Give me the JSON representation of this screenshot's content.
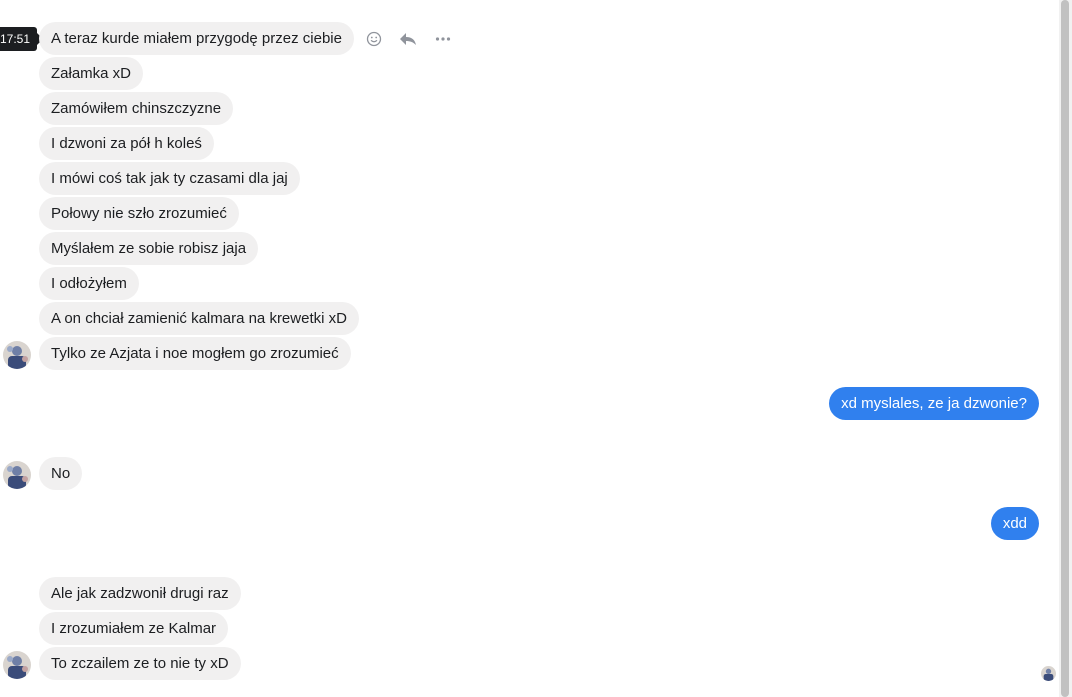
{
  "tooltip": {
    "time": "17:51"
  },
  "actions": {
    "react_icon": "smiley-icon",
    "reply_icon": "reply-icon",
    "more_icon": "more-icon"
  },
  "messages": [
    {
      "text": "A teraz kurde miałem przygodę przez ciebie",
      "direction": "in"
    },
    {
      "text": "Załamka xD",
      "direction": "in"
    },
    {
      "text": "Zamówiłem chinszczyzne",
      "direction": "in"
    },
    {
      "text": "I dzwoni za pół h koleś",
      "direction": "in"
    },
    {
      "text": "I mówi coś tak jak ty czasami dla jaj",
      "direction": "in"
    },
    {
      "text": "Połowy nie szło zrozumieć",
      "direction": "in"
    },
    {
      "text": "Myślałem ze sobie robisz jaja",
      "direction": "in"
    },
    {
      "text": "I odłożyłem",
      "direction": "in"
    },
    {
      "text": "A on chciał zamienić kalmara na krewetki xD",
      "direction": "in"
    },
    {
      "text": "Tylko ze Azjata i noe mogłem go zrozumieć",
      "direction": "in"
    },
    {
      "text": "xd myslales, ze ja dzwonie?",
      "direction": "out"
    },
    {
      "text": "No",
      "direction": "in"
    },
    {
      "text": "xdd",
      "direction": "out"
    },
    {
      "text": "Ale jak zadzwonił drugi raz",
      "direction": "in"
    },
    {
      "text": "I zrozumiałem ze Kalmar",
      "direction": "in"
    },
    {
      "text": "To zczailem ze to nie ty xD",
      "direction": "in"
    }
  ],
  "colors": {
    "incoming_bg": "#f1f0f0",
    "outgoing_bg": "#3080ee",
    "text_dark": "#1c1e21"
  }
}
